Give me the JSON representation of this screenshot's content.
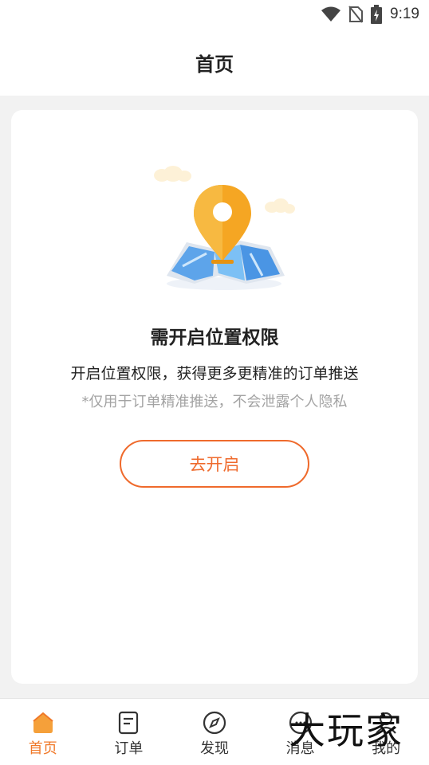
{
  "status_bar": {
    "time": "9:19",
    "icons": [
      "wifi-icon",
      "no-sim-icon",
      "battery-charging-icon"
    ]
  },
  "header": {
    "title": "首页"
  },
  "card": {
    "illustration": "location-map-icon",
    "title": "需开启位置权限",
    "description": "开启位置权限，获得更多更精准的订单推送",
    "note": "*仅用于订单精准推送，不会泄露个人隐私",
    "button_label": "去开启"
  },
  "tabbar": {
    "active_color": "#f07828",
    "items": [
      {
        "label": "首页",
        "icon": "home-icon",
        "active": true
      },
      {
        "label": "订单",
        "icon": "order-icon",
        "active": false
      },
      {
        "label": "发现",
        "icon": "compass-icon",
        "active": false
      },
      {
        "label": "消息",
        "icon": "message-icon",
        "active": false
      },
      {
        "label": "我的",
        "icon": "profile-icon",
        "active": false
      }
    ]
  },
  "watermark": "大玩家"
}
